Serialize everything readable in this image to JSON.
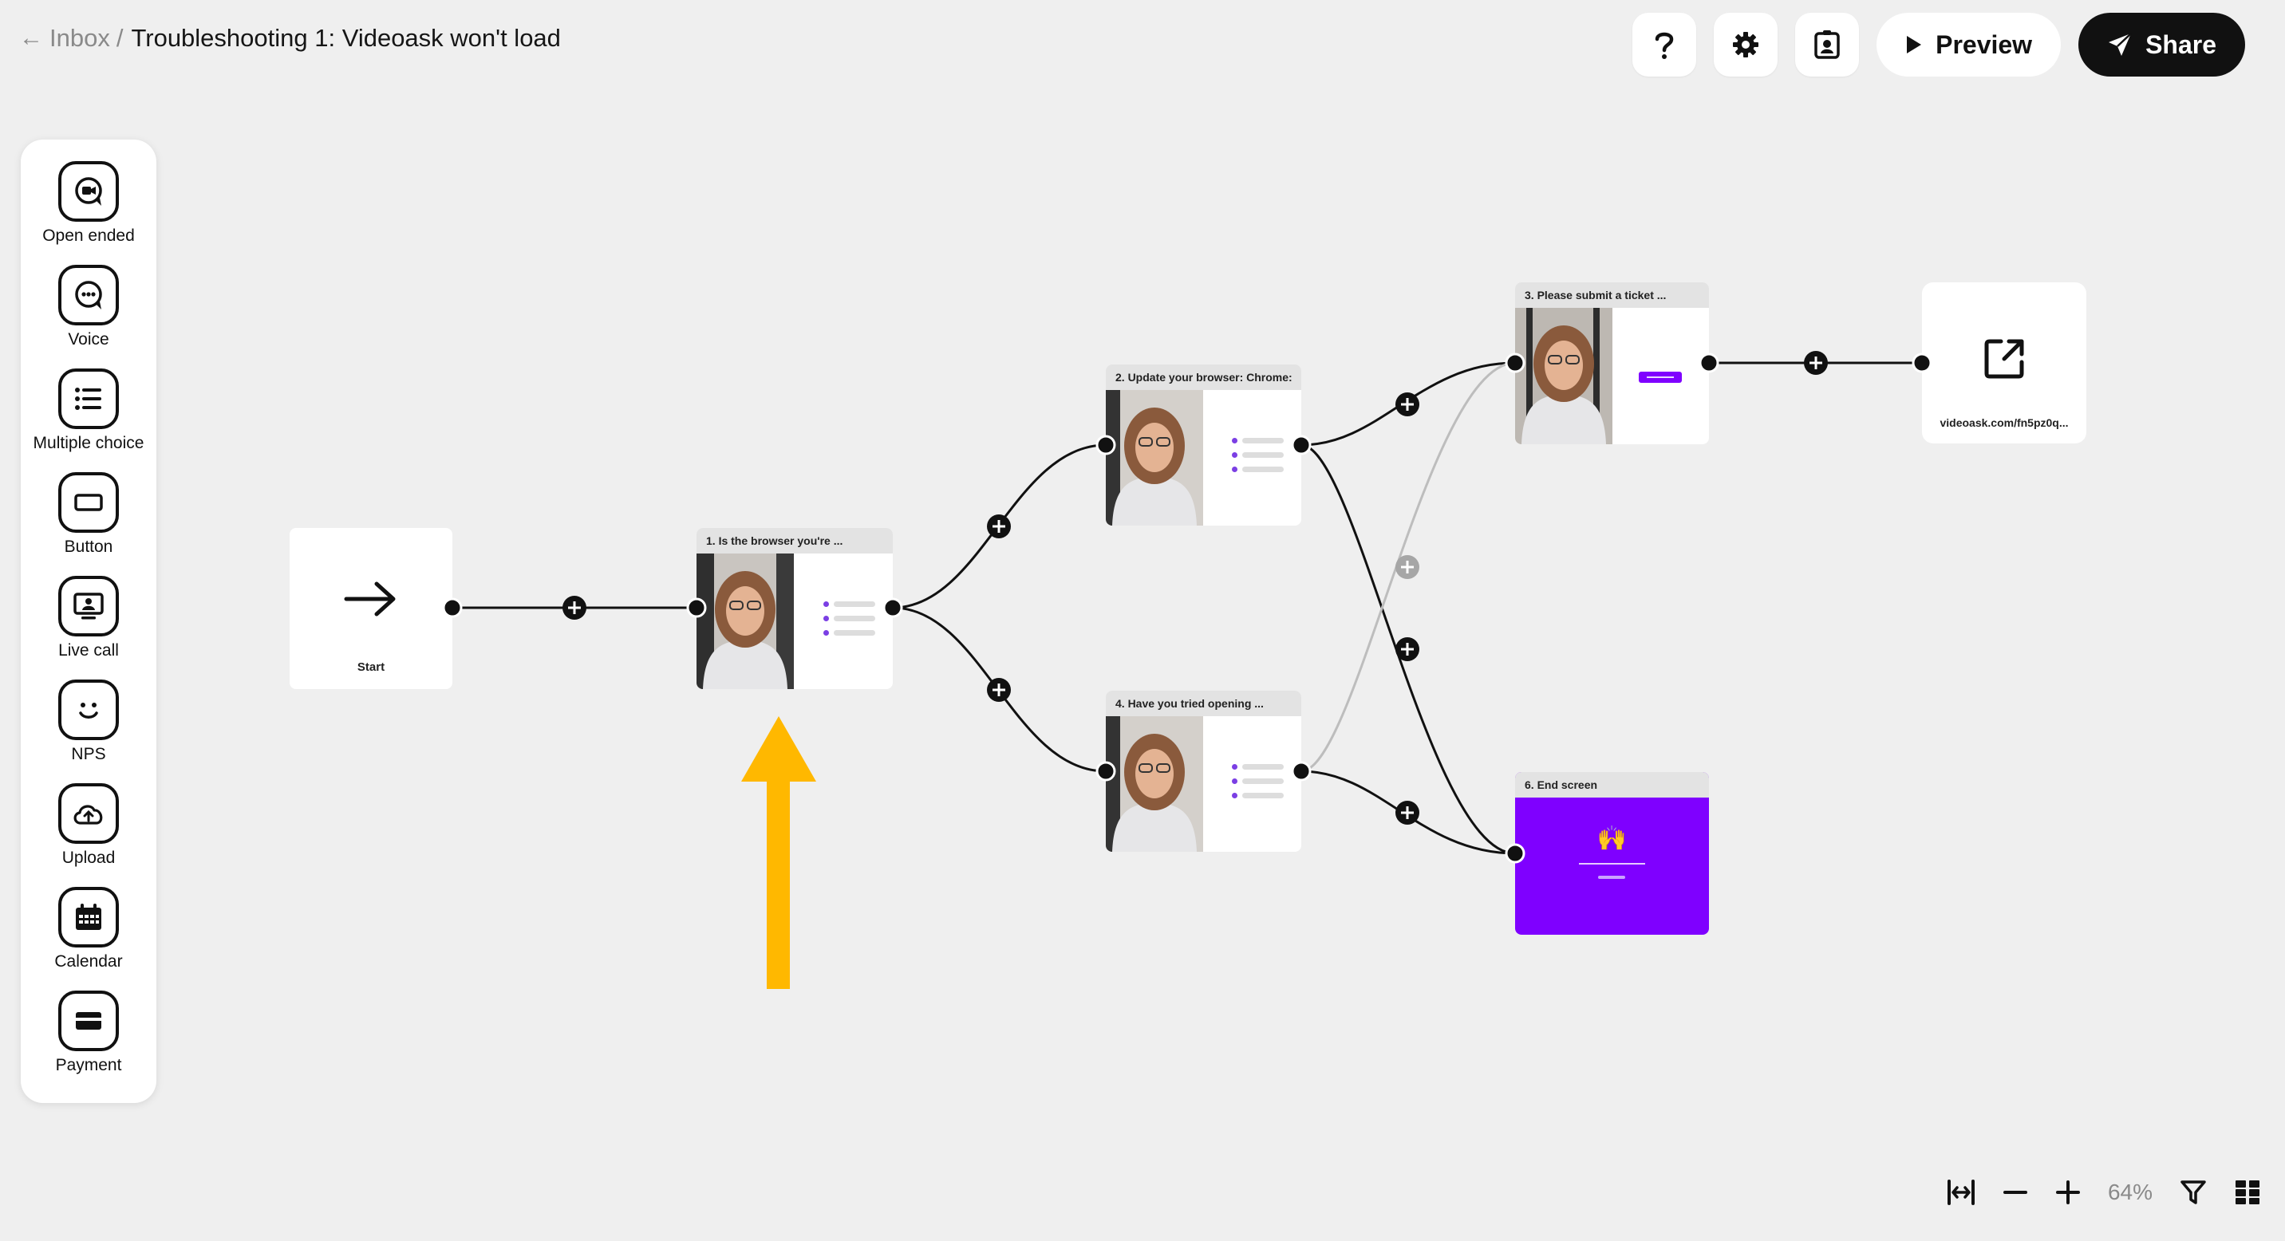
{
  "header": {
    "back_label": "Inbox",
    "separator": "/",
    "title": "Troubleshooting 1: Videoask won't load",
    "preview_label": "Preview",
    "share_label": "Share",
    "icons": [
      "help-icon",
      "settings-icon",
      "contact-card-icon",
      "play-icon",
      "send-icon"
    ]
  },
  "sidebar": {
    "items": [
      {
        "label": "Open ended",
        "icon": "video-chat-icon"
      },
      {
        "label": "Voice",
        "icon": "voice-chat-icon"
      },
      {
        "label": "Multiple choice",
        "icon": "list-icon"
      },
      {
        "label": "Button",
        "icon": "button-icon"
      },
      {
        "label": "Live call",
        "icon": "live-call-icon"
      },
      {
        "label": "NPS",
        "icon": "smiley-icon"
      },
      {
        "label": "Upload",
        "icon": "cloud-upload-icon"
      },
      {
        "label": "Calendar",
        "icon": "calendar-icon"
      },
      {
        "label": "Payment",
        "icon": "card-icon"
      }
    ]
  },
  "nodes": {
    "start": {
      "label": "Start"
    },
    "step1": {
      "title": "1. Is the browser you're ..."
    },
    "step2": {
      "title": "2. Update your browser: Chrome:"
    },
    "step3": {
      "title": "3. Please submit a ticket ..."
    },
    "step4": {
      "title": "4. Have you tried opening ..."
    },
    "step6": {
      "title": "6. End screen",
      "emoji": "🙌"
    },
    "redirect": {
      "url": "videoask.com/fn5pz0q..."
    }
  },
  "colors": {
    "accent_purple": "#7f00ff",
    "annotation_arrow": "#ffb800",
    "background": "#efefef"
  },
  "footer": {
    "zoom_level": "64%",
    "icons": [
      "fit-width-icon",
      "zoom-out-icon",
      "zoom-in-icon",
      "filter-icon",
      "layout-icon"
    ]
  }
}
